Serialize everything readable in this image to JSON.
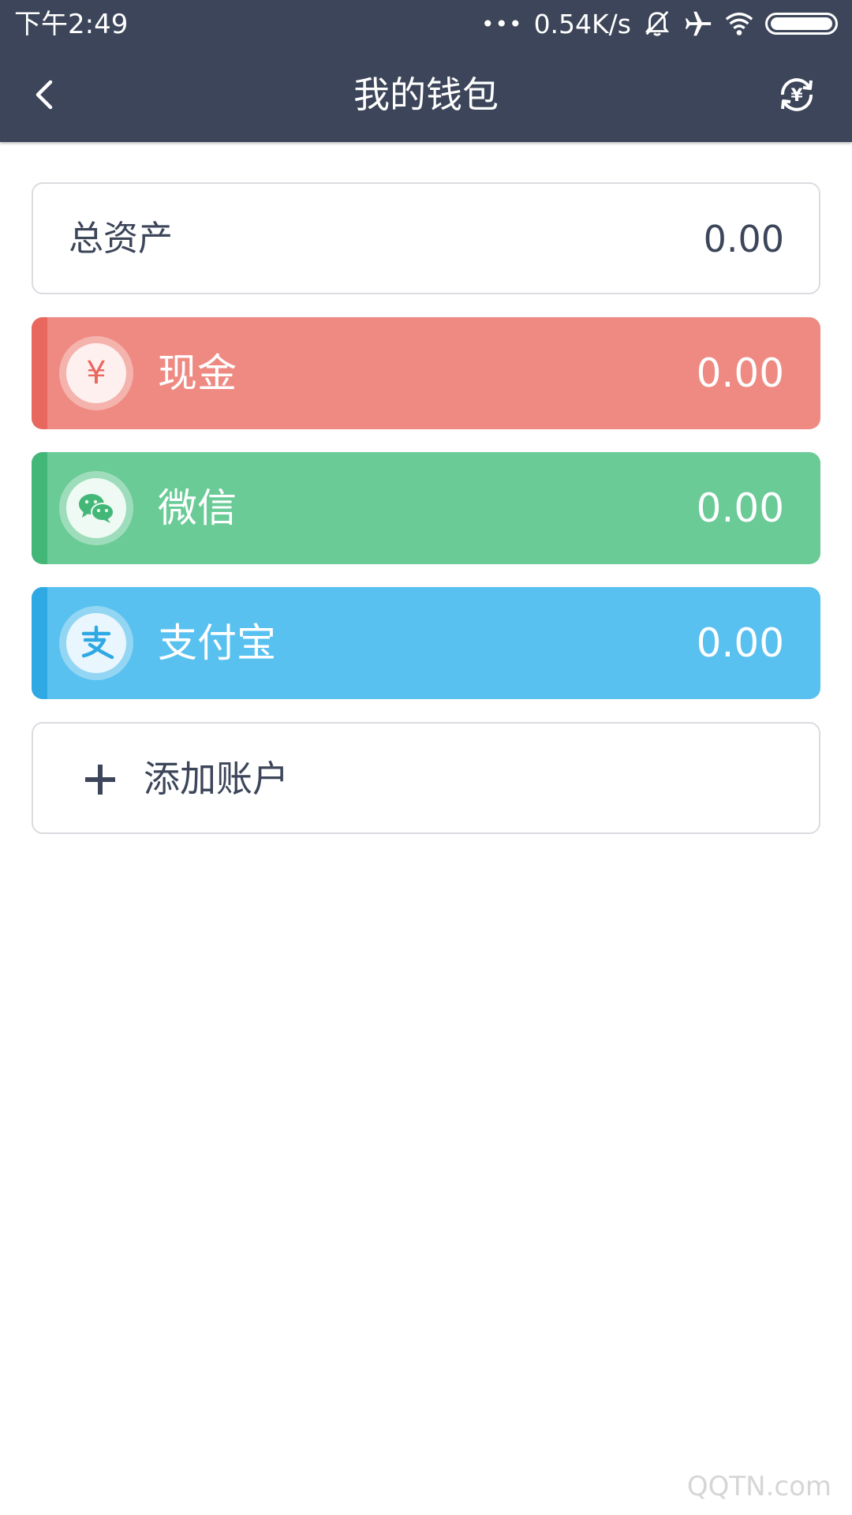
{
  "status_bar": {
    "time": "下午2:49",
    "dots": "•••",
    "net_speed": "0.54K/s",
    "icons": [
      "bell-off-icon",
      "airplane-icon",
      "wifi-icon",
      "battery-icon"
    ]
  },
  "header": {
    "title": "我的钱包",
    "back_icon": "chevron-left-icon",
    "action_icon": "currency-exchange-icon"
  },
  "total": {
    "label": "总资产",
    "value": "0.00"
  },
  "accounts": [
    {
      "name": "现金",
      "value": "0.00",
      "icon": "yuan-icon",
      "color": "#ef8a82"
    },
    {
      "name": "微信",
      "value": "0.00",
      "icon": "wechat-icon",
      "color": "#6acb97"
    },
    {
      "name": "支付宝",
      "value": "0.00",
      "icon": "alipay-icon",
      "color": "#59c1ef"
    }
  ],
  "add_account": {
    "label": "添加账户",
    "icon": "plus-icon"
  },
  "watermark": {
    "text": "QQTN.com"
  },
  "colors": {
    "header_bg": "#3c4559",
    "text_dark": "#3c4559",
    "border": "#dadce0"
  }
}
